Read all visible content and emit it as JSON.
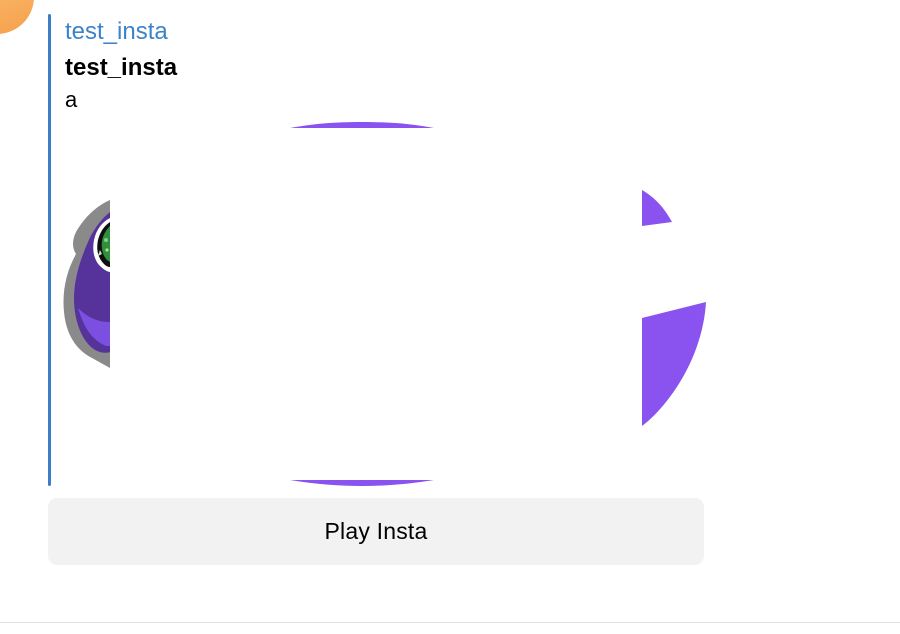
{
  "message": {
    "avatar_color": "#f4a04c",
    "accent_color": "#3d7fc7",
    "game": {
      "site_name": "test_insta",
      "title": "test_insta",
      "description": "a"
    }
  },
  "button": {
    "label": "Play Insta"
  }
}
